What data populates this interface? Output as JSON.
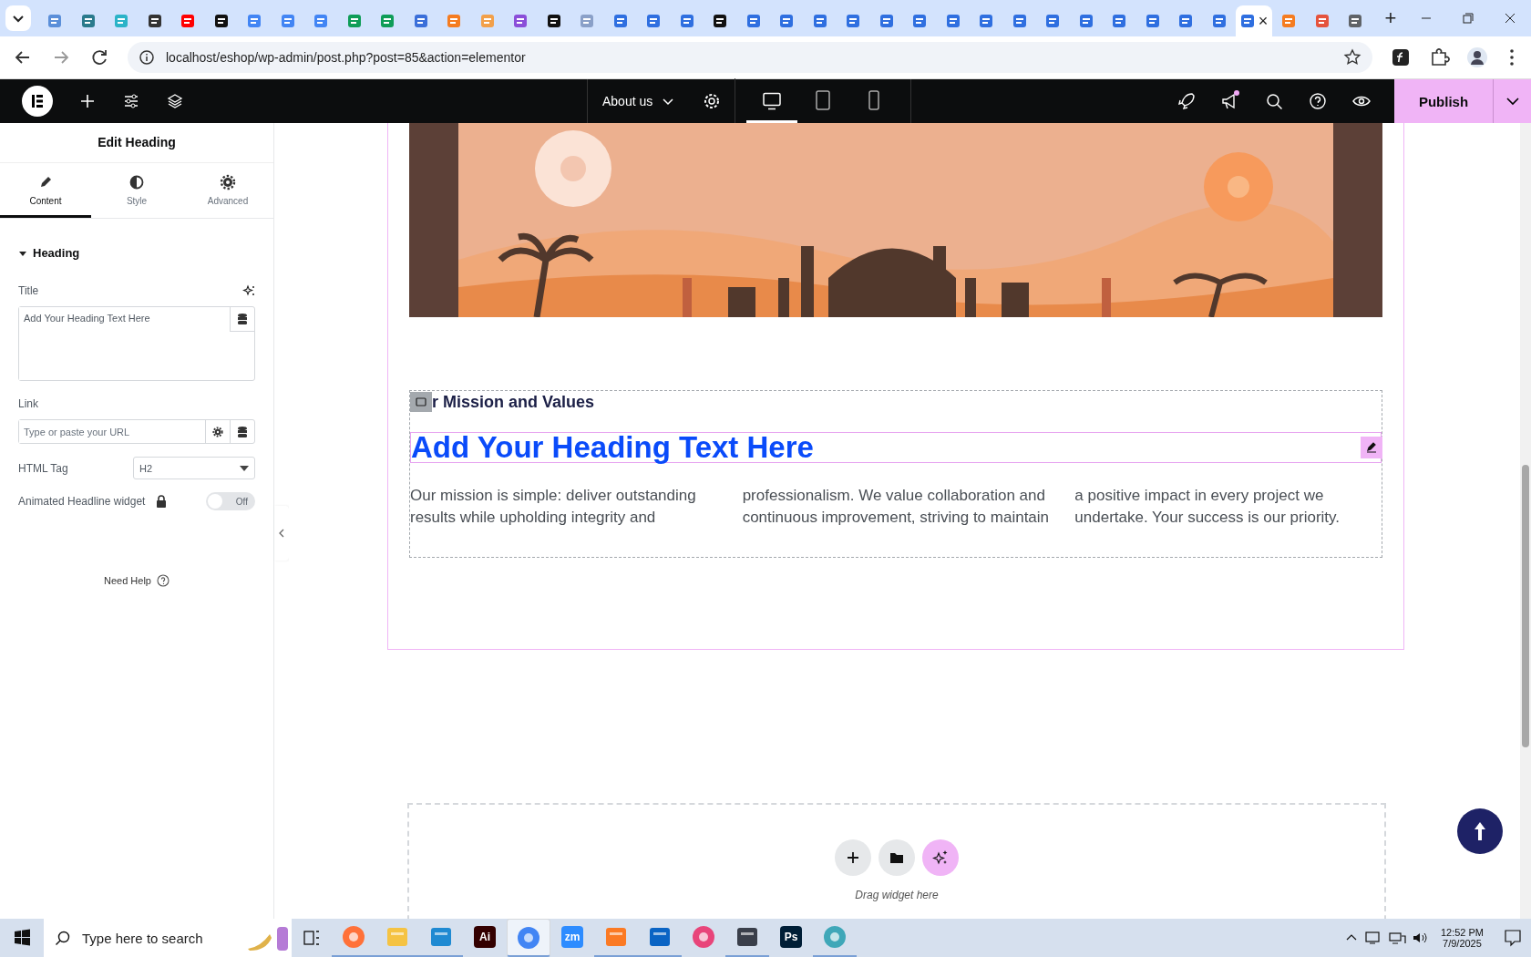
{
  "browser": {
    "tabs": [
      {
        "color": "#5b8fd9",
        "selected": false
      },
      {
        "color": "#2a7a8c",
        "selected": false
      },
      {
        "color": "#2bb3c8",
        "selected": false
      },
      {
        "color": "#333333",
        "selected": false
      },
      {
        "color": "#ff0000",
        "selected": false
      },
      {
        "color": "#111111",
        "selected": false
      },
      {
        "color": "#4285f4",
        "selected": false
      },
      {
        "color": "#4285f4",
        "selected": false
      },
      {
        "color": "#4285f4",
        "selected": false
      },
      {
        "color": "#0f9d58",
        "selected": false
      },
      {
        "color": "#0f9d58",
        "selected": false
      },
      {
        "color": "#3b6fd9",
        "selected": false
      },
      {
        "color": "#f57c20",
        "selected": false
      },
      {
        "color": "#f2a04a",
        "selected": false
      },
      {
        "color": "#8a4fd9",
        "selected": false
      },
      {
        "color": "#111111",
        "selected": false
      },
      {
        "color": "#8aa0c8",
        "selected": false
      },
      {
        "color": "#2f6fe0",
        "selected": false
      },
      {
        "color": "#2f6fe0",
        "selected": false
      },
      {
        "color": "#2f6fe0",
        "selected": false
      },
      {
        "color": "#111111",
        "selected": false
      },
      {
        "color": "#2f6fe0",
        "selected": false
      },
      {
        "color": "#2f6fe0",
        "selected": false
      },
      {
        "color": "#2f6fe0",
        "selected": false
      },
      {
        "color": "#2f6fe0",
        "selected": false
      },
      {
        "color": "#2f6fe0",
        "selected": false
      },
      {
        "color": "#2f6fe0",
        "selected": false
      },
      {
        "color": "#2f6fe0",
        "selected": false
      },
      {
        "color": "#2f6fe0",
        "selected": false
      },
      {
        "color": "#2f6fe0",
        "selected": false
      },
      {
        "color": "#2f6fe0",
        "selected": false
      },
      {
        "color": "#2f6fe0",
        "selected": false
      },
      {
        "color": "#2f6fe0",
        "selected": false
      },
      {
        "color": "#2f6fe0",
        "selected": false
      },
      {
        "color": "#2f6fe0",
        "selected": false
      },
      {
        "color": "#2f6fe0",
        "selected": false
      },
      {
        "color": "#2f6fe0",
        "selected": true
      },
      {
        "color": "#f57c20",
        "selected": false
      },
      {
        "color": "#e5533d",
        "selected": false
      },
      {
        "color": "#5f6368",
        "selected": false
      }
    ],
    "close_tab": "×",
    "new_tab": "+",
    "url": "localhost/eshop/wp-admin/post.php?post=85&action=elementor"
  },
  "editor_bar": {
    "page_title": "About us",
    "devices": [
      {
        "kind": "desktop",
        "selected": true
      },
      {
        "kind": "tablet",
        "selected": false
      },
      {
        "kind": "mobile",
        "selected": false
      }
    ],
    "publish": "Publish"
  },
  "panel": {
    "title": "Edit Heading",
    "tabs": [
      {
        "kind": "content",
        "label": "Content",
        "selected": true
      },
      {
        "kind": "style",
        "label": "Style",
        "selected": false
      },
      {
        "kind": "advanced",
        "label": "Advanced",
        "selected": false
      }
    ],
    "section": {
      "label": "Heading",
      "expanded": true
    },
    "title_label": "Title",
    "title_value": "Add Your Heading Text Here",
    "link_label": "Link",
    "link_placeholder": "Type or paste your URL",
    "tag_label": "HTML Tag",
    "tag_value": "H2",
    "animated_label": "Animated Headline widget",
    "animated_toggle": {
      "on": false,
      "label": "Off"
    },
    "help": "Need Help"
  },
  "canvas": {
    "partial_heading": "r Mission and Values",
    "heading": "Add Your Heading Text Here",
    "paragraph": "Our mission is simple: deliver outstanding results while upholding integrity and professionalism. We value collaboration and continuous improvement, striving to maintain a positive impact in every project we undertake. Your success is our priority.",
    "drop_hint": "Drag widget here"
  },
  "taskbar": {
    "search_placeholder": "Type here to search",
    "apps": [
      {
        "kind": "round",
        "color": "#ff7139",
        "selected": false,
        "running": true
      },
      {
        "kind": "tile",
        "color": "#f5c343",
        "selected": false,
        "running": true
      },
      {
        "kind": "tile",
        "color": "#1f8ad2",
        "selected": false,
        "running": true
      },
      {
        "kind": "badge",
        "color": "#330000",
        "label": "Ai",
        "selected": false,
        "running": false
      },
      {
        "kind": "round",
        "color": "#4285f4",
        "selected": true,
        "running": true
      },
      {
        "kind": "badge",
        "color": "#2d8cff",
        "label": "zm",
        "selected": false,
        "running": false
      },
      {
        "kind": "tile",
        "color": "#fb7a24",
        "selected": false,
        "running": true
      },
      {
        "kind": "tile",
        "color": "#0a64c4",
        "selected": false,
        "running": true
      },
      {
        "kind": "round",
        "color": "#e8457a",
        "selected": false,
        "running": false
      },
      {
        "kind": "tile",
        "color": "#3a3f4a",
        "selected": false,
        "running": true
      },
      {
        "kind": "badge",
        "color": "#001e36",
        "label": "Ps",
        "selected": false,
        "running": false
      },
      {
        "kind": "round",
        "color": "#3fa7b8",
        "selected": false,
        "running": true
      }
    ],
    "time": "12:52 PM",
    "date": "7/9/2025"
  }
}
